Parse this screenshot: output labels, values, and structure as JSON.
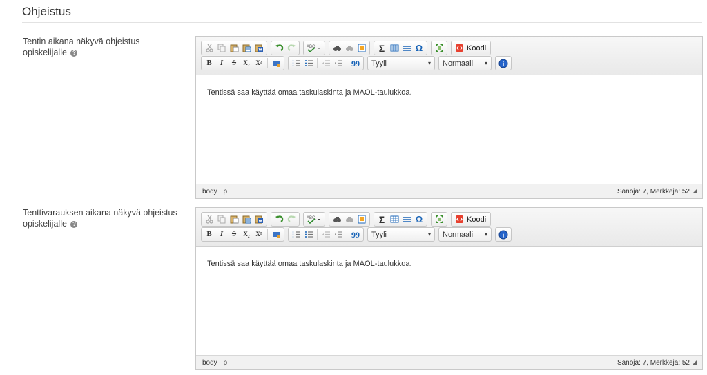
{
  "section": {
    "title": "Ohjeistus"
  },
  "help_glyph": "?",
  "fields": [
    {
      "label_line1": "Tentin aikana näkyvä ohjeistus",
      "label_line2": "opiskelijalle",
      "content": "Tentissä saa käyttää omaa taskulaskinta ja MAOL-taulukkoa.",
      "path": [
        "body",
        "p"
      ],
      "stats": "Sanoja: 7, Merkkejä: 52"
    },
    {
      "label_line1": "Tenttivarauksen aikana näkyvä ohjeistus",
      "label_line2": "opiskelijalle",
      "content": "Tentissä saa käyttää omaa taskulaskinta ja MAOL-taulukkoa.",
      "path": [
        "body",
        "p"
      ],
      "stats": "Sanoja: 7, Merkkejä: 52"
    }
  ],
  "toolbar": {
    "source_label": "Koodi",
    "style_label": "Tyyli",
    "format_label": "Normaali",
    "bold_glyph": "B",
    "italic_glyph": "I",
    "strike_glyph": "S",
    "subscript_glyph": "X₂",
    "superscript_glyph": "X²",
    "blockquote_glyph": "99",
    "sigma_glyph": "Σ",
    "omega_glyph": "Ω",
    "about_glyph": "i",
    "dropdown_glyph": "▾"
  },
  "colors": {
    "accent_blue": "#1a65b8",
    "undo_green": "#3a8f2c",
    "icon_gray": "#9a9a9a"
  }
}
